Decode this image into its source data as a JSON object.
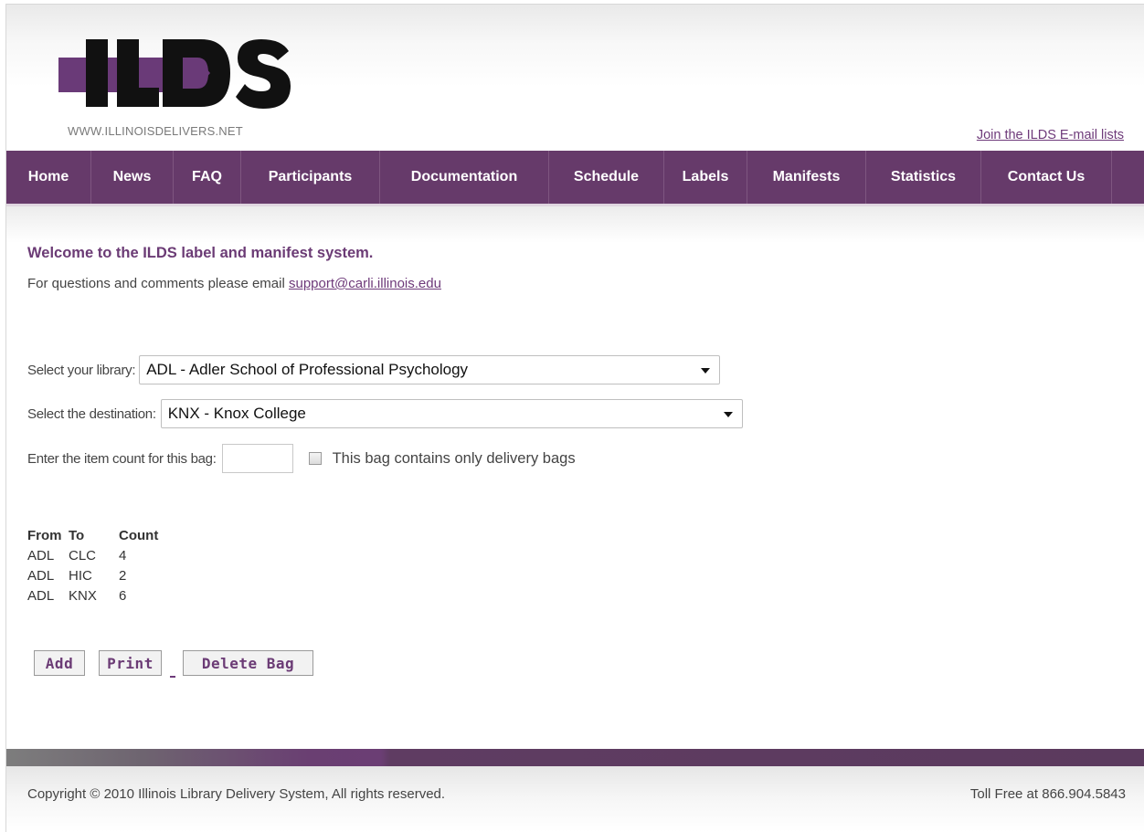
{
  "header": {
    "logo_text": "ILDS",
    "logo_url": "WWW.ILLINOISDELIVERS.NET",
    "email_lists_link": "Join the ILDS E-mail lists"
  },
  "nav": {
    "items": [
      {
        "label": "Home"
      },
      {
        "label": "News"
      },
      {
        "label": "FAQ"
      },
      {
        "label": "Participants"
      },
      {
        "label": "Documentation"
      },
      {
        "label": "Schedule"
      },
      {
        "label": "Labels"
      },
      {
        "label": "Manifests"
      },
      {
        "label": "Statistics"
      },
      {
        "label": "Contact Us"
      }
    ]
  },
  "main": {
    "welcome": "Welcome to the ILDS label and manifest system.",
    "questions_text": "For questions and comments please email ",
    "support_email": "support@carli.illinois.edu",
    "library_label": "Select your library:",
    "library_value": "ADL - Adler School of Professional Psychology",
    "destination_label": "Select the destination:",
    "destination_value": "KNX - Knox College",
    "count_label": "Enter the item count for this bag:",
    "count_value": "",
    "delivery_bags_label": "This bag contains only delivery bags"
  },
  "table": {
    "headers": [
      "From",
      "To",
      "Count"
    ],
    "rows": [
      [
        "ADL",
        "CLC",
        "4"
      ],
      [
        "ADL",
        "HIC",
        "2"
      ],
      [
        "ADL",
        "KNX",
        "6"
      ]
    ]
  },
  "buttons": {
    "add": "Add",
    "print": "Print",
    "delete": "Delete Bag"
  },
  "footer": {
    "copyright": "Copyright © 2010 Illinois Library Delivery System, All rights reserved.",
    "tollfree": "Toll Free at 866.904.5843"
  },
  "colors": {
    "brand_purple": "#663a6a",
    "link_purple": "#6e3a7a"
  }
}
